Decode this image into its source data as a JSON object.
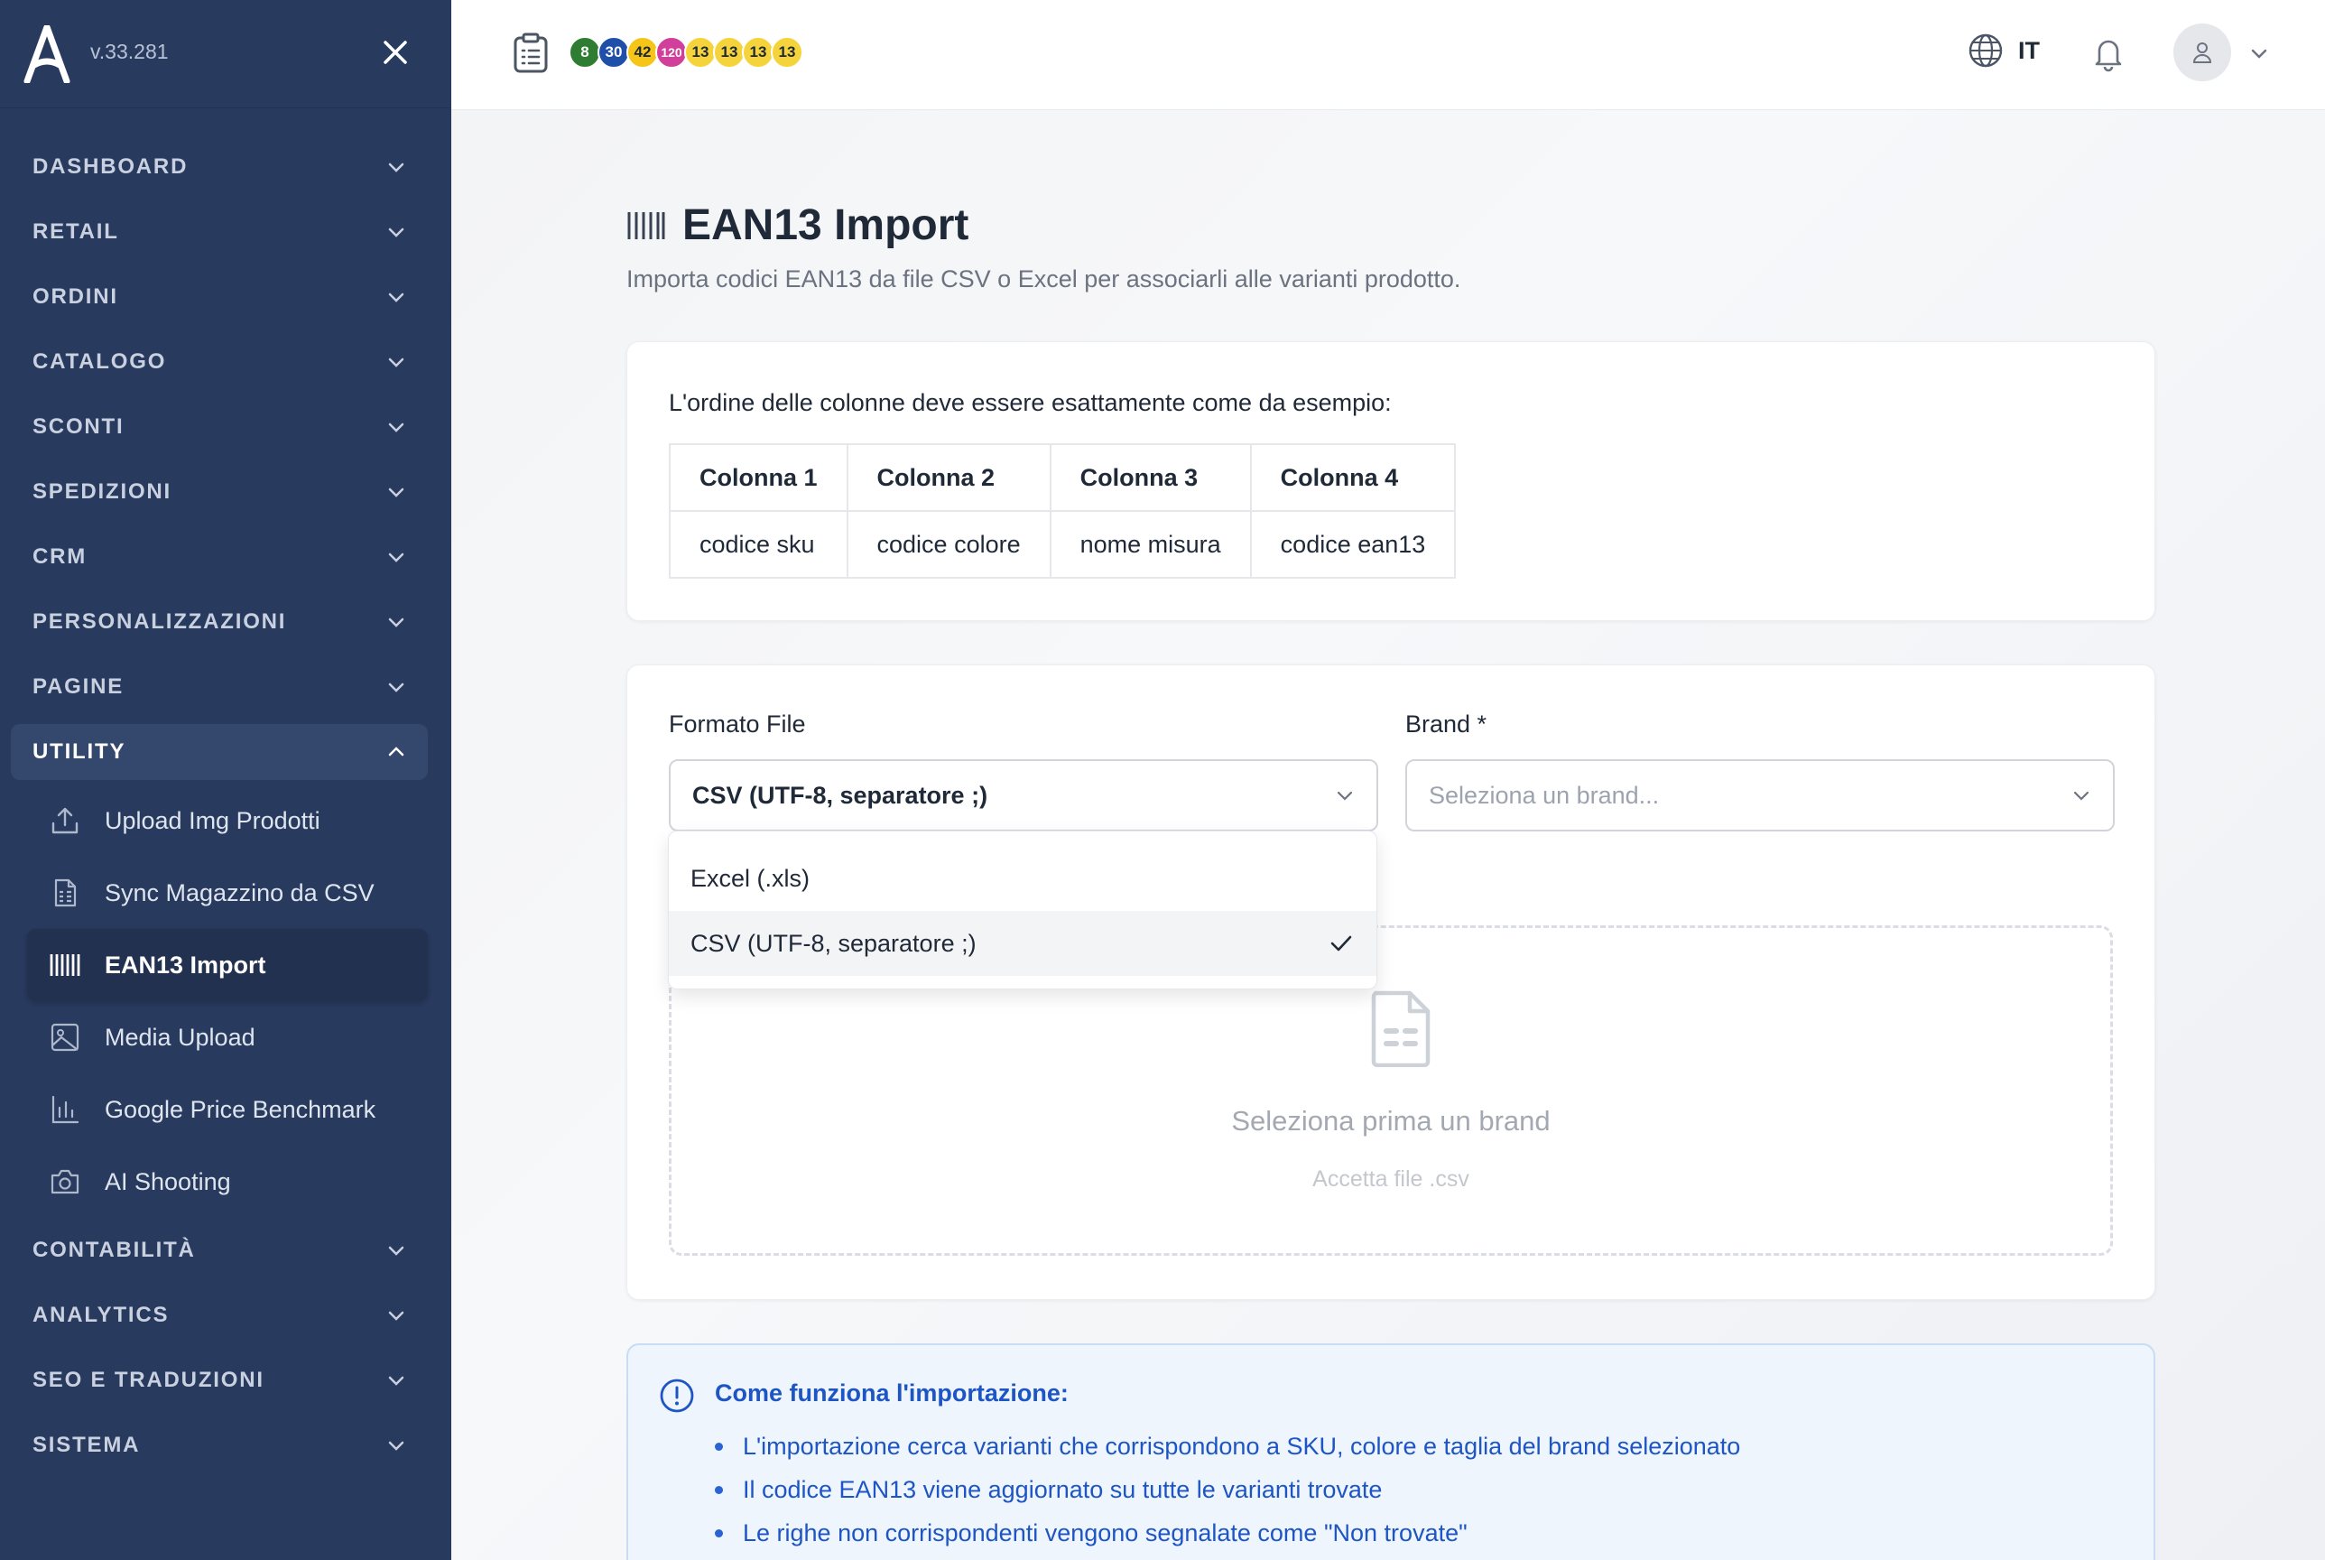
{
  "app": {
    "version": "v.33.281"
  },
  "sidebar": {
    "sections": [
      {
        "label": "DASHBOARD"
      },
      {
        "label": "RETAIL"
      },
      {
        "label": "ORDINI"
      },
      {
        "label": "CATALOGO"
      },
      {
        "label": "SCONTI"
      },
      {
        "label": "SPEDIZIONI"
      },
      {
        "label": "CRM"
      },
      {
        "label": "PERSONALIZZAZIONI"
      },
      {
        "label": "PAGINE"
      }
    ],
    "open_section": {
      "label": "UTILITY"
    },
    "utility_items": [
      {
        "label": "Upload Img Prodotti",
        "icon": "upload-icon"
      },
      {
        "label": "Sync Magazzino da CSV",
        "icon": "spreadsheet-icon"
      },
      {
        "label": "EAN13 Import",
        "icon": "barcode-icon",
        "active": true
      },
      {
        "label": "Media Upload",
        "icon": "image-icon"
      },
      {
        "label": "Google Price Benchmark",
        "icon": "bar-chart-icon"
      },
      {
        "label": "AI Shooting",
        "icon": "camera-icon"
      }
    ],
    "sections_after": [
      {
        "label": "CONTABILITÀ"
      },
      {
        "label": "ANALYTICS"
      },
      {
        "label": "SEO E TRADUZIONI"
      },
      {
        "label": "SISTEMA"
      }
    ]
  },
  "topbar": {
    "badges": [
      {
        "value": "8",
        "color": "#2f7d32",
        "text_color": "#ffffff"
      },
      {
        "value": "30",
        "color": "#1f4fa8",
        "text_color": "#ffffff"
      },
      {
        "value": "42",
        "color": "#f5c518",
        "text_color": "#1f2937"
      },
      {
        "value": "120",
        "color": "#d13f9b",
        "text_color": "#ffffff"
      },
      {
        "value": "13",
        "color": "#f5d33a",
        "text_color": "#1f2937"
      },
      {
        "value": "13",
        "color": "#f5d33a",
        "text_color": "#1f2937"
      },
      {
        "value": "13",
        "color": "#f5d33a",
        "text_color": "#1f2937"
      },
      {
        "value": "13",
        "color": "#f5d33a",
        "text_color": "#1f2937"
      }
    ],
    "language": "IT"
  },
  "page": {
    "title": "EAN13 Import",
    "subtitle": "Importa codici EAN13 da file CSV o Excel per associarli alle varianti prodotto."
  },
  "columns_card": {
    "intro": "L'ordine delle colonne deve essere esattamente come da esempio:",
    "headers": [
      "Colonna 1",
      "Colonna 2",
      "Colonna 3",
      "Colonna 4"
    ],
    "values": [
      "codice sku",
      "codice colore",
      "nome misura",
      "codice ean13"
    ]
  },
  "form": {
    "format_label": "Formato File",
    "format_value": "CSV (UTF-8, separatore ;)",
    "format_options": [
      {
        "label": "Excel (.xls)",
        "selected": false
      },
      {
        "label": "CSV (UTF-8, separatore ;)",
        "selected": true
      }
    ],
    "brand_label": "Brand *",
    "brand_placeholder": "Seleziona un brand...",
    "dropzone_title": "Seleziona prima un brand",
    "dropzone_subtitle": "Accetta file .csv"
  },
  "info": {
    "title": "Come funziona l'importazione:",
    "items": [
      "L'importazione cerca varianti che corrispondono a SKU, colore e taglia del brand selezionato",
      "Il codice EAN13 viene aggiornato su tutte le varianti trovate",
      "Le righe non corrispondenti vengono segnalate come \"Non trovate\""
    ]
  },
  "colors": {
    "sidebar_bg": "#283a5e",
    "accent_blue": "#1e55c4",
    "info_bg": "#eef5fd"
  }
}
